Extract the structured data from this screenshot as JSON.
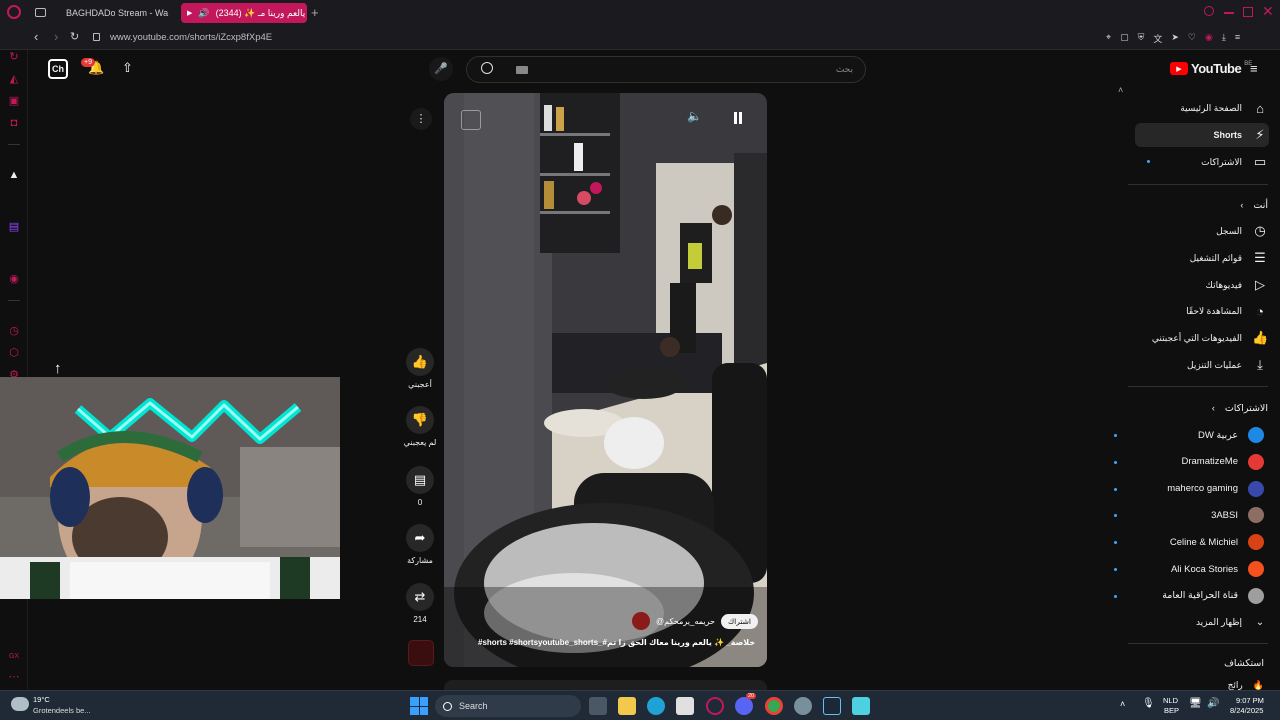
{
  "browser": {
    "tabs": [
      {
        "title": "BAGHDADo Stream - Wa"
      },
      {
        "title": "يالعم ورينا مـ ✨ (2344)"
      }
    ],
    "url": "www.youtube.com/shorts/iZcxp8fXp4E"
  },
  "yt": {
    "logo_text": "YouTube",
    "logo_region": "BE",
    "search_placeholder": "بحث",
    "notif_badge": "+9",
    "nav": [
      {
        "label": "الصفحة الرئيسية",
        "icon": "home-icon"
      },
      {
        "label": "Shorts",
        "icon": "shorts-icon"
      },
      {
        "label": "الاشتراكات",
        "icon": "subscriptions-icon"
      }
    ],
    "you_header": "أنت",
    "you_items": [
      {
        "label": "السجل",
        "icon": "history-icon"
      },
      {
        "label": "قوائم التشغيل",
        "icon": "playlist-icon"
      },
      {
        "label": "فيديوهاتك",
        "icon": "your-videos-icon"
      },
      {
        "label": "المشاهدة لاحقًا",
        "icon": "watch-later-icon"
      },
      {
        "label": "الفيديوهات التي أعجبتني",
        "icon": "like-icon"
      },
      {
        "label": "عمليات التنزيل",
        "icon": "download-icon"
      }
    ],
    "subs_header": "الاشتراكات",
    "subscriptions": [
      {
        "name": "DW عربية",
        "color": "#1e88e5"
      },
      {
        "name": "DramatizeMe",
        "color": "#e53935"
      },
      {
        "name": "maherco gaming",
        "color": "#3949ab"
      },
      {
        "name": "3ABSI",
        "color": "#8d6e63"
      },
      {
        "name": "Celine & Michiel",
        "color": "#d84315"
      },
      {
        "name": "Ali Koca Stories",
        "color": "#f4511e"
      },
      {
        "name": "قناة الحراقية العامة",
        "color": "#9e9e9e"
      }
    ],
    "show_more": "إظهار المزيد",
    "explore_header": "استكشاف",
    "explore_partial": "رائج",
    "actions": {
      "like_label": "أعجبني",
      "dislike_label": "لم يعجبني",
      "comments_count": "0",
      "share_label": "مشاركة",
      "remix_count": "214"
    },
    "video": {
      "channel_handle": "@حريمه_يرمحكم",
      "subscribe_label": "اشتراك",
      "caption": "#shorts #shortsyoutube_shorts_#خلاصة_ ✨ يالعم ورينا معاك الحق زا تم"
    }
  },
  "webcam": {
    "label": "streamer webcam"
  },
  "taskbar": {
    "weather_temp": "19°C",
    "weather_desc": "Grotendeels be...",
    "search_label": "Search",
    "lang_top": "NLD",
    "lang_bottom": "BEP",
    "time": "9:07 PM",
    "date": "8/24/2025",
    "discord_badge": "20"
  },
  "colors": {
    "accent": "#c2185b",
    "yt_red": "#ff0000",
    "bg": "#0f0f0f"
  }
}
